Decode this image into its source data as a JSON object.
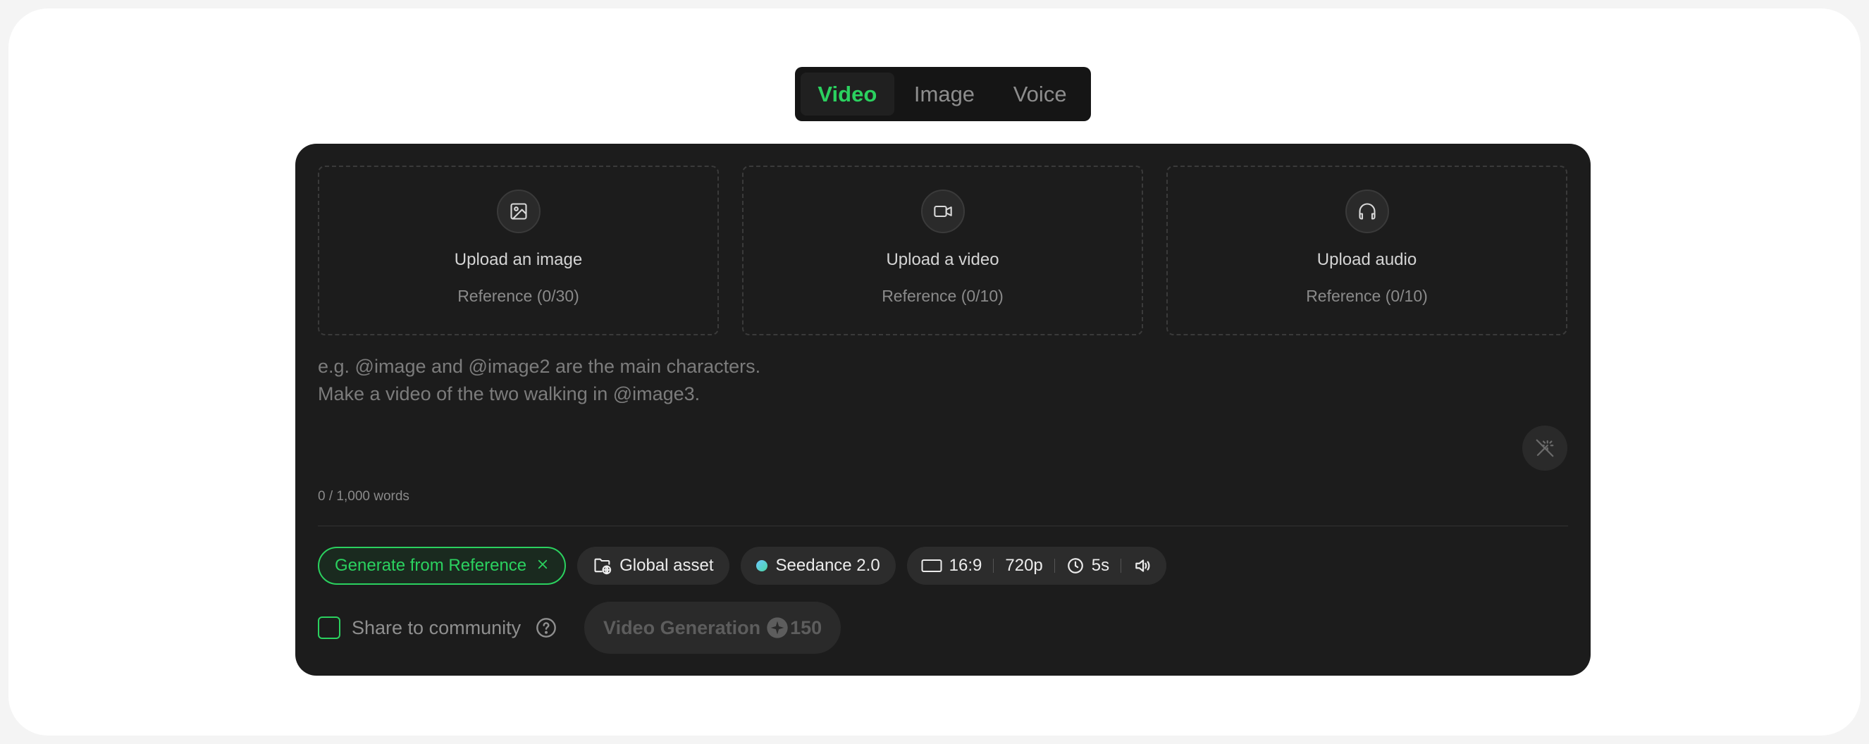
{
  "tabs": [
    {
      "label": "Video",
      "active": true
    },
    {
      "label": "Image",
      "active": false
    },
    {
      "label": "Voice",
      "active": false
    }
  ],
  "uploads": [
    {
      "icon": "image-icon",
      "title": "Upload an image",
      "ref_label": "Reference",
      "count": "(0/30)"
    },
    {
      "icon": "video-camera-icon",
      "title": "Upload a video",
      "ref_label": "Reference",
      "count": "(0/10)"
    },
    {
      "icon": "headphones-icon",
      "title": "Upload audio",
      "ref_label": "Reference",
      "count": "(0/10)"
    }
  ],
  "prompt": {
    "placeholder": "e.g. @image and @image2 are the main characters.\nMake a video of the two walking in @image3.",
    "value": ""
  },
  "counter": "0 / 1,000 words",
  "chips": {
    "reference": "Generate from Reference",
    "global_asset": "Global asset",
    "model": "Seedance 2.0"
  },
  "settings": {
    "ratio": "16:9",
    "resolution": "720p",
    "duration": "5s"
  },
  "share_label": "Share to community",
  "generate": {
    "label": "Video Generation",
    "cost": "150"
  },
  "colors": {
    "accent": "#2bd15f",
    "card_bg": "#1c1c1c",
    "page_bg": "#ffffff"
  }
}
